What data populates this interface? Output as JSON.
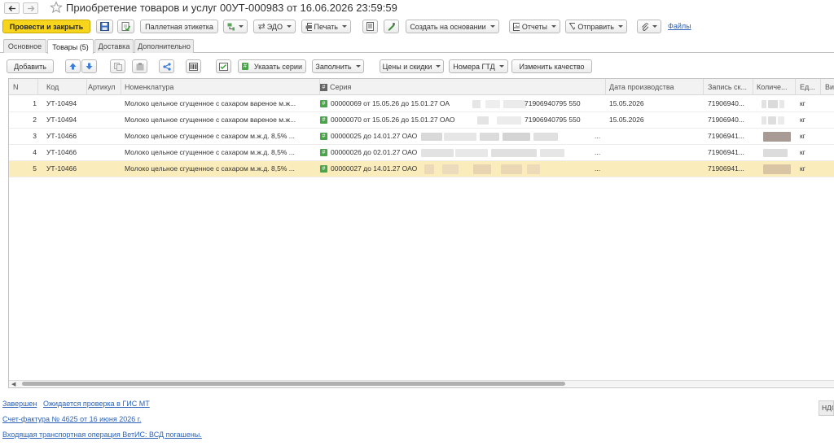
{
  "window": {
    "title": "Приобретение товаров и услуг 00УТ-000983 от 16.06.2026 23:59:59"
  },
  "toolbar": {
    "post_close_label": "Провести и закрыть",
    "pallet_label": "Паллетная этикетка",
    "edo_label": "ЭДО",
    "print_label": "Печать",
    "create_based_label": "Создать на основании",
    "reports_label": "Отчеты",
    "send_label": "Отправить",
    "files_label": "Файлы"
  },
  "tabs": [
    {
      "label": "Основное",
      "active": false
    },
    {
      "label": "Товары (5)",
      "active": true
    },
    {
      "label": "Доставка",
      "active": false
    },
    {
      "label": "Дополнительно",
      "active": false
    }
  ],
  "goods_toolbar": {
    "add_label": "Добавить",
    "specify_series_label": "Указать серии",
    "fill_label": "Заполнить",
    "prices_label": "Цены и скидки",
    "gtd_label": "Номера ГТД",
    "change_quality_label": "Изменить качество"
  },
  "table": {
    "columns": [
      "N",
      "Код",
      "Артикул",
      "Номенклатура",
      "Серия",
      "Дата производства",
      "Запись ск...",
      "Количе...",
      "Ед...",
      "Ви"
    ],
    "rows": [
      {
        "n": "1",
        "code": "УТ-10494",
        "article": "",
        "name": "Молоко цельное сгущенное с сахаром  вареное м.ж...",
        "series": "00000069 от 15.05.26 до 15.01.27 ОА",
        "series_tail": "71906940795 550",
        "prod_date": "15.05.2026",
        "record": "71906940...",
        "unit": "кг"
      },
      {
        "n": "2",
        "code": "УТ-10494",
        "article": "",
        "name": "Молоко цельное сгущенное с сахаром  вареное м.ж...",
        "series": "00000070 от 15.05.26 до 15.01.27 ОАО",
        "series_tail": "71906940795 550",
        "prod_date": "15.05.2026",
        "record": "71906940...",
        "unit": "кг"
      },
      {
        "n": "3",
        "code": "УТ-10466",
        "article": "",
        "name": "Молоко цельное сгущенное с сахаром м.ж.д. 8,5% ...",
        "series": "00000025 до 14.01.27 ОАО",
        "series_tail": "...",
        "prod_date": "",
        "record": "71906941...",
        "unit": "кг"
      },
      {
        "n": "4",
        "code": "УТ-10466",
        "article": "",
        "name": "Молоко цельное сгущенное с сахаром м.ж.д. 8,5% ...",
        "series": "00000026 до 02.01.27 ОАО",
        "series_tail": "...",
        "prod_date": "",
        "record": "71906941...",
        "unit": "кг"
      },
      {
        "n": "5",
        "code": "УТ-10466",
        "article": "",
        "name": "Молоко цельное сгущенное с сахаром м.ж.д. 8,5% ...",
        "series": "00000027 до 14.01.27 ОАО",
        "series_tail": "...",
        "prod_date": "",
        "record": "71906941...",
        "unit": "кг",
        "selected": true
      }
    ]
  },
  "footer": {
    "status_done": "Завершен",
    "status_check": "Ожидается проверка в ГИС МТ",
    "invoice_link": "Счет-фактура № 4625 от 16 июня 2026 г.",
    "vetis_link": "Входящая транспортная операция ВетИС: ВСД погашены.",
    "vat_label": "НДС"
  },
  "colors": {
    "primary": "#f7d51d",
    "selected_row": "#fbedbb",
    "link": "#2d62b8",
    "series_mark": "#4aa44a"
  }
}
